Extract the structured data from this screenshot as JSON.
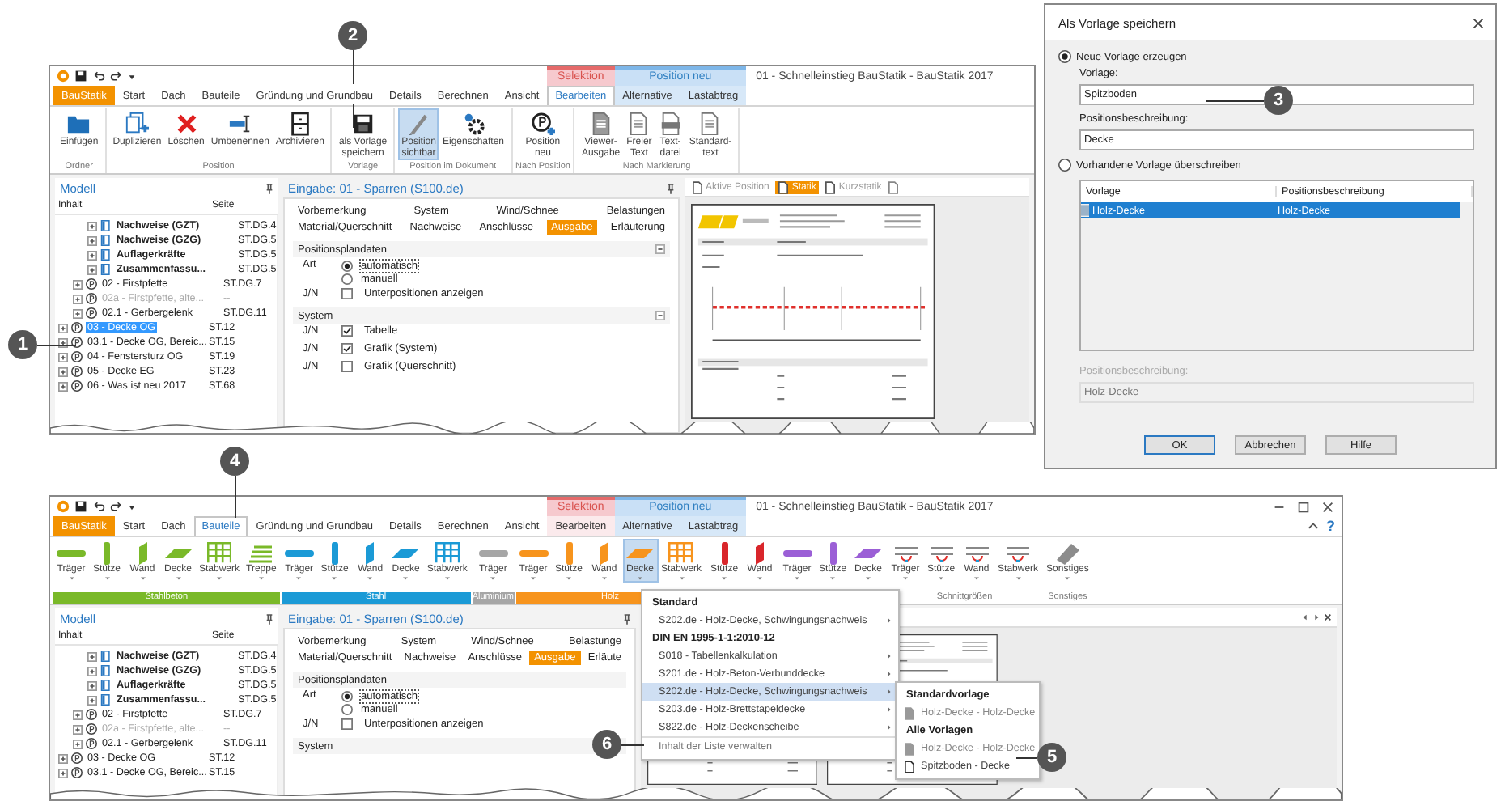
{
  "callouts": [
    {
      "number": "1"
    },
    {
      "number": "2"
    },
    {
      "number": "3"
    },
    {
      "number": "4"
    },
    {
      "number": "5"
    },
    {
      "number": "6"
    }
  ],
  "top_window": {
    "title": "01 - Schnelleinstieg BauStatik - BauStatik 2017",
    "context_groups": [
      {
        "label": "Selektion",
        "kind": "selection"
      },
      {
        "label": "Position neu",
        "kind": "position"
      }
    ],
    "tabs": [
      {
        "label": "BauStatik",
        "kind": "app",
        "selected": false
      },
      {
        "label": "Start",
        "kind": "normal",
        "selected": false
      },
      {
        "label": "Dach",
        "kind": "normal",
        "selected": false
      },
      {
        "label": "Bauteile",
        "kind": "normal",
        "selected": false
      },
      {
        "label": "Gründung und Grundbau",
        "kind": "normal",
        "selected": false
      },
      {
        "label": "Details",
        "kind": "normal",
        "selected": false
      },
      {
        "label": "Berechnen",
        "kind": "normal",
        "selected": false
      },
      {
        "label": "Ansicht",
        "kind": "normal",
        "selected": false
      },
      {
        "label": "Bearbeiten",
        "kind": "selection",
        "selected": true
      },
      {
        "label": "Alternative",
        "kind": "position",
        "selected": false
      },
      {
        "label": "Lastabtrag",
        "kind": "position",
        "selected": false
      }
    ],
    "ribbon_groups": [
      {
        "label": "Ordner",
        "buttons": [
          {
            "lines": [
              "Einfügen"
            ],
            "kind": "folder",
            "pressed": false
          }
        ]
      },
      {
        "label": "Position",
        "buttons": [
          {
            "lines": [
              "Duplizieren"
            ],
            "kind": "duplicate",
            "pressed": false
          },
          {
            "lines": [
              "Löschen"
            ],
            "kind": "delete",
            "pressed": false
          },
          {
            "lines": [
              "Umbenennen"
            ],
            "kind": "rename",
            "pressed": false
          },
          {
            "lines": [
              "Archivieren"
            ],
            "kind": "archive",
            "pressed": false
          }
        ]
      },
      {
        "label": "Vorlage",
        "buttons": [
          {
            "lines": [
              "als Vorlage",
              "speichern"
            ],
            "kind": "save",
            "pressed": false
          }
        ]
      },
      {
        "label": "Position im Dokument",
        "buttons": [
          {
            "lines": [
              "Position",
              "sichtbar"
            ],
            "kind": "visible",
            "pressed": true
          },
          {
            "lines": [
              "Eigenschaften"
            ],
            "kind": "properties",
            "pressed": false
          }
        ]
      },
      {
        "label": "Nach Position",
        "buttons": [
          {
            "lines": [
              "Position",
              "neu"
            ],
            "kind": "newpos",
            "pressed": false
          }
        ]
      },
      {
        "label": "Nach Markierung",
        "buttons": [
          {
            "lines": [
              "Viewer-",
              "Ausgabe"
            ],
            "kind": "viewer",
            "pressed": false
          },
          {
            "lines": [
              "Freier",
              "Text"
            ],
            "kind": "text",
            "pressed": false
          },
          {
            "lines": [
              "Text-",
              "datei"
            ],
            "kind": "textfile",
            "pressed": false
          },
          {
            "lines": [
              "Standard-",
              "text"
            ],
            "kind": "text",
            "pressed": false
          }
        ]
      }
    ],
    "model": {
      "title": "Modell",
      "columns": [
        "Inhalt",
        "Seite"
      ],
      "tree": [
        {
          "children": [
            {
              "children": [
                {
                  "label": "Nachweise (GZT)",
                  "page": "ST.DG.4",
                  "kind": "document",
                  "selected": false,
                  "disabled": false
                },
                {
                  "label": "Nachweise (GZG)",
                  "page": "ST.DG.5",
                  "kind": "document",
                  "selected": false,
                  "disabled": false
                },
                {
                  "label": "Auflagerkräfte",
                  "page": "ST.DG.5",
                  "kind": "document",
                  "selected": false,
                  "disabled": false
                },
                {
                  "label": "Zusammenfassu...",
                  "page": "ST.DG.5",
                  "kind": "document",
                  "selected": false,
                  "disabled": false
                }
              ]
            },
            {
              "label": "02 - Firstpfette",
              "page": "ST.DG.7",
              "kind": "position",
              "selected": false,
              "disabled": false
            },
            {
              "label": "02a - Firstpfette, alte...",
              "page": "--",
              "kind": "position",
              "selected": false,
              "disabled": true
            },
            {
              "label": "02.1 - Gerbergelenk",
              "page": "ST.DG.11",
              "kind": "position",
              "selected": false,
              "disabled": false
            }
          ]
        },
        {
          "label": "03 - Decke OG",
          "page": "ST.12",
          "kind": "position",
          "selected": true,
          "disabled": false
        },
        {
          "label": "03.1 - Decke OG, Bereic...",
          "page": "ST.15",
          "kind": "position",
          "selected": false,
          "disabled": false
        },
        {
          "label": "04 - Fenstersturz OG",
          "page": "ST.19",
          "kind": "position",
          "selected": false,
          "disabled": false
        },
        {
          "label": "05 - Decke EG",
          "page": "ST.23",
          "kind": "position",
          "selected": false,
          "disabled": false
        },
        {
          "label": "06 - Was ist neu 2017",
          "page": "ST.68",
          "kind": "position",
          "selected": false,
          "disabled": false
        }
      ]
    },
    "input": {
      "title": "Eingabe: 01 - Sparren (S100.de)",
      "tab_rows": [
        [
          {
            "label": "Vorbemerkung",
            "selected": false
          },
          {
            "label": "System",
            "selected": false
          },
          {
            "label": "Wind/Schnee",
            "selected": false
          },
          {
            "label": "Belastungen",
            "selected": false
          }
        ],
        [
          {
            "label": "Material/Querschnitt",
            "selected": false
          },
          {
            "label": "Nachweise",
            "selected": false
          },
          {
            "label": "Anschlüsse",
            "selected": false
          },
          {
            "label": "Ausgabe",
            "selected": true
          },
          {
            "label": "Erläuterung",
            "selected": false
          }
        ]
      ],
      "sections": [
        {
          "title": "Positionsplandaten",
          "rows": [
            {
              "kind": "radio",
              "label": "Art",
              "options": [
                {
                  "label": "automatisch",
                  "selected": true
                },
                {
                  "label": "manuell",
                  "selected": false
                }
              ]
            },
            {
              "kind": "check",
              "label": "J/N",
              "text": "Unterpositionen anzeigen",
              "checked": false
            }
          ]
        },
        {
          "title": "System",
          "rows": [
            {
              "kind": "check",
              "label": "J/N",
              "text": "Tabelle",
              "checked": true
            },
            {
              "kind": "check",
              "label": "J/N",
              "text": "Grafik (System)",
              "checked": true
            },
            {
              "kind": "check",
              "label": "J/N",
              "text": "Grafik (Querschnitt)",
              "checked": false
            }
          ]
        }
      ]
    },
    "preview": {
      "tabs": [
        {
          "label": "Aktive Position",
          "selected": false
        },
        {
          "label": "Statik",
          "selected": true
        },
        {
          "label": "Kurzstatik",
          "selected": false
        }
      ]
    }
  },
  "dialog": {
    "title": "Als Vorlage speichern",
    "options": [
      {
        "label": "Neue Vorlage erzeugen",
        "selected": true
      },
      {
        "label": "Vorhandene Vorlage überschreiben",
        "selected": false
      }
    ],
    "fields": [
      {
        "label": "Vorlage:",
        "value": "Spitzboden"
      },
      {
        "label": "Positionsbeschreibung:",
        "value": "Decke"
      }
    ],
    "table": {
      "columns": [
        "Vorlage",
        "Positionsbeschreibung"
      ],
      "rows": [
        {
          "cells": [
            "Holz-Decke",
            "Holz-Decke"
          ],
          "selected": true
        }
      ]
    },
    "disabled_field": {
      "label": "Positionsbeschreibung:",
      "value": "Holz-Decke"
    },
    "buttons": [
      {
        "label": "OK",
        "default": true
      },
      {
        "label": "Abbrechen",
        "default": false
      },
      {
        "label": "Hilfe",
        "default": false
      }
    ]
  },
  "bottom_window": {
    "title": "01 - Schnelleinstieg BauStatik - BauStatik 2017",
    "window_controls": true,
    "help_label": "?",
    "context_groups": [
      {
        "label": "Selektion",
        "kind": "selection"
      },
      {
        "label": "Position neu",
        "kind": "position"
      }
    ],
    "tabs": [
      {
        "label": "BauStatik",
        "kind": "app",
        "selected": false
      },
      {
        "label": "Start",
        "kind": "normal",
        "selected": false
      },
      {
        "label": "Dach",
        "kind": "normal",
        "selected": false
      },
      {
        "label": "Bauteile",
        "kind": "normal",
        "selected": true
      },
      {
        "label": "Gründung und Grundbau",
        "kind": "normal",
        "selected": false
      },
      {
        "label": "Details",
        "kind": "normal",
        "selected": false
      },
      {
        "label": "Berechnen",
        "kind": "normal",
        "selected": false
      },
      {
        "label": "Ansicht",
        "kind": "normal",
        "selected": false
      },
      {
        "label": "Bearbeiten",
        "kind": "selection",
        "selected": false
      },
      {
        "label": "Alternative",
        "kind": "position",
        "selected": false
      },
      {
        "label": "Lastabtrag",
        "kind": "position",
        "selected": false
      }
    ],
    "component_groups": [
      {
        "label": "Stahlbeton",
        "color": "#7ab929",
        "buttons": [
          {
            "label": "Träger",
            "kind": "beam",
            "selected": false
          },
          {
            "label": "Stütze",
            "kind": "column",
            "selected": false
          },
          {
            "label": "Wand",
            "kind": "wall",
            "selected": false
          },
          {
            "label": "Decke",
            "kind": "slab",
            "selected": false
          },
          {
            "label": "Stabwerk",
            "kind": "frame",
            "selected": false
          },
          {
            "label": "Treppe",
            "kind": "stair",
            "selected": false
          }
        ]
      },
      {
        "label": "Stahl",
        "color": "#1b9ad6",
        "buttons": [
          {
            "label": "Träger",
            "kind": "beam",
            "selected": false
          },
          {
            "label": "Stütze",
            "kind": "column",
            "selected": false
          },
          {
            "label": "Wand",
            "kind": "wall",
            "selected": false
          },
          {
            "label": "Decke",
            "kind": "slab",
            "selected": false
          },
          {
            "label": "Stabwerk",
            "kind": "frame",
            "selected": false
          }
        ]
      },
      {
        "label": "Aluminium",
        "color": "#a6a6a6",
        "buttons": [
          {
            "label": "Träger",
            "kind": "beam",
            "selected": false
          }
        ]
      },
      {
        "label": "Holz",
        "color": "#f7941d",
        "buttons": [
          {
            "label": "Träger",
            "kind": "beam",
            "selected": false
          },
          {
            "label": "Stütze",
            "kind": "column",
            "selected": false
          },
          {
            "label": "Wand",
            "kind": "wall",
            "selected": false
          },
          {
            "label": "Decke",
            "kind": "slab",
            "selected": true
          },
          {
            "label": "Stabwerk",
            "kind": "frame",
            "selected": false
          }
        ]
      },
      {
        "color": "#d9262b",
        "buttons": [
          {
            "label": "Stütze",
            "kind": "column",
            "selected": false
          },
          {
            "label": "Wand",
            "kind": "wall",
            "selected": false
          }
        ]
      },
      {
        "color": "#9b5fd6",
        "buttons": [
          {
            "label": "Träger",
            "kind": "beam",
            "selected": false
          },
          {
            "label": "Stütze",
            "kind": "column",
            "selected": false
          },
          {
            "label": "Decke",
            "kind": "slab",
            "selected": false
          }
        ]
      },
      {
        "label": "Schnittgrößen",
        "buttons": [
          {
            "label": "Träger",
            "kind": "cut",
            "selected": false
          },
          {
            "label": "Stütze",
            "kind": "cut",
            "selected": false
          },
          {
            "label": "Wand",
            "kind": "cut",
            "selected": false
          },
          {
            "label": "Stabwerk",
            "kind": "cut",
            "selected": false
          }
        ]
      },
      {
        "label": "Sonstiges",
        "buttons": [
          {
            "label": "Sonstiges",
            "kind": "misc",
            "selected": false
          }
        ]
      }
    ],
    "model": {
      "title": "Modell",
      "columns": [
        "Inhalt",
        "Seite"
      ],
      "tree": [
        {
          "children": [
            {
              "children": [
                {
                  "label": "Nachweise (GZT)",
                  "page": "ST.DG.4",
                  "kind": "document",
                  "selected": false,
                  "disabled": false
                },
                {
                  "label": "Nachweise (GZG)",
                  "page": "ST.DG.5",
                  "kind": "document",
                  "selected": false,
                  "disabled": false
                },
                {
                  "label": "Auflagerkräfte",
                  "page": "ST.DG.5",
                  "kind": "document",
                  "selected": false,
                  "disabled": false
                },
                {
                  "label": "Zusammenfassu...",
                  "page": "ST.DG.5",
                  "kind": "document",
                  "selected": false,
                  "disabled": false
                }
              ]
            },
            {
              "label": "02 - Firstpfette",
              "page": "ST.DG.7",
              "kind": "position",
              "selected": false,
              "disabled": false
            },
            {
              "label": "02a - Firstpfette, alte...",
              "page": "--",
              "kind": "position",
              "selected": false,
              "disabled": true
            },
            {
              "label": "02.1 - Gerbergelenk",
              "page": "ST.DG.11",
              "kind": "position",
              "selected": false,
              "disabled": false
            }
          ]
        },
        {
          "label": "03 - Decke OG",
          "page": "ST.12",
          "kind": "position",
          "selected": false,
          "disabled": false
        },
        {
          "label": "03.1 - Decke OG, Bereic...",
          "page": "ST.15",
          "kind": "position",
          "selected": false,
          "disabled": false
        }
      ]
    },
    "input": {
      "title": "Eingabe: 01 - Sparren (S100.de)",
      "tab_rows": [
        [
          {
            "label": "Vorbemerkung",
            "selected": false
          },
          {
            "label": "System",
            "selected": false
          },
          {
            "label": "Wind/Schnee",
            "selected": false
          },
          {
            "label": "Belastunge",
            "selected": false
          }
        ],
        [
          {
            "label": "Material/Querschnitt",
            "selected": false
          },
          {
            "label": "Nachweise",
            "selected": false
          },
          {
            "label": "Anschlüsse",
            "selected": false
          },
          {
            "label": "Ausgabe",
            "selected": true
          },
          {
            "label": "Erläute",
            "selected": false
          }
        ]
      ],
      "sections": [
        {
          "title": "Positionsplandaten",
          "rows": [
            {
              "kind": "radio",
              "label": "Art",
              "options": [
                {
                  "label": "automatisch",
                  "selected": true
                },
                {
                  "label": "manuell",
                  "selected": false
                }
              ]
            },
            {
              "kind": "check",
              "label": "J/N",
              "text": "Unterpositionen anzeigen",
              "checked": false
            }
          ]
        },
        {
          "title": "System"
        }
      ]
    },
    "preview": {
      "navigation": true
    },
    "menu": {
      "items": [
        {
          "kind": "header",
          "label": "Standard"
        },
        {
          "kind": "item",
          "label": "S202.de - Holz-Decke, Schwingungsnachweis",
          "submenu": true,
          "selected": false
        },
        {
          "kind": "header",
          "label": "DIN EN 1995-1-1:2010-12"
        },
        {
          "kind": "item",
          "label": "S018 - Tabellenkalkulation",
          "submenu": true,
          "selected": false
        },
        {
          "kind": "item",
          "label": "S201.de - Holz-Beton-Verbunddecke",
          "submenu": true,
          "selected": false
        },
        {
          "kind": "item",
          "label": "S202.de - Holz-Decke, Schwingungsnachweis",
          "submenu": true,
          "selected": true
        },
        {
          "kind": "item",
          "label": "S203.de - Holz-Brettstapeldecke",
          "submenu": true,
          "selected": false
        },
        {
          "kind": "item",
          "label": "S822.de - Holz-Deckenscheibe",
          "submenu": true,
          "selected": false
        },
        {
          "kind": "action",
          "label": "Inhalt der Liste verwalten",
          "submenu": false,
          "selected": false
        }
      ],
      "submenu": [
        {
          "kind": "header",
          "label": "Standardvorlage"
        },
        {
          "kind": "standard_template",
          "label": "Holz-Decke - Holz-Decke"
        },
        {
          "kind": "header",
          "label": "Alle Vorlagen"
        },
        {
          "kind": "standard_template",
          "label": "Holz-Decke - Holz-Decke"
        },
        {
          "kind": "user_template",
          "label": "Spitzboden - Decke"
        }
      ]
    }
  }
}
